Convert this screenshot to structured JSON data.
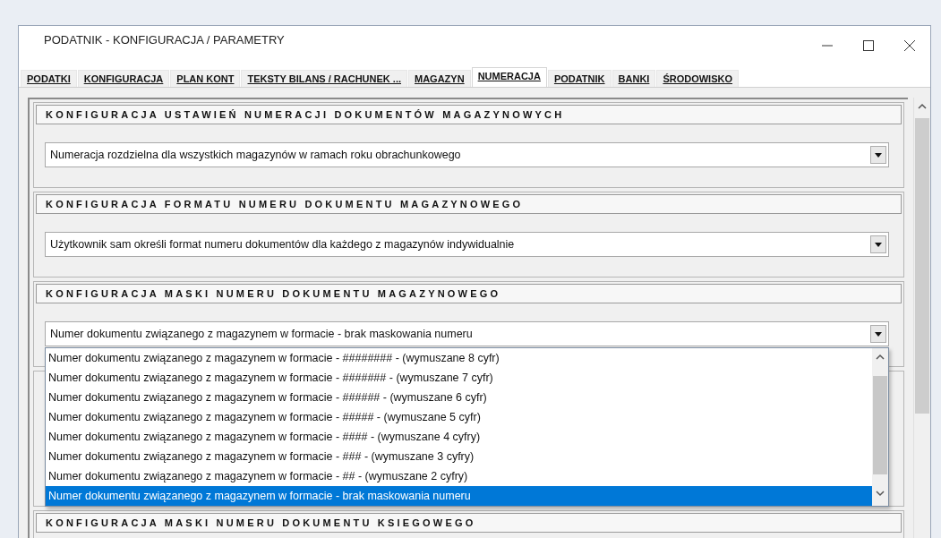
{
  "window": {
    "title": "PODATNIK  - KONFIGURACJA / PARAMETRY"
  },
  "tabs": [
    {
      "label": "PODATKI",
      "selected": false
    },
    {
      "label": "KONFIGURACJA",
      "selected": false
    },
    {
      "label": "PLAN KONT",
      "selected": false
    },
    {
      "label": "TEKSTY BILANS / RACHUNEK ...",
      "selected": false
    },
    {
      "label": "MAGAZYN",
      "selected": false
    },
    {
      "label": "NUMERACJA",
      "selected": true
    },
    {
      "label": "PODATNIK",
      "selected": false
    },
    {
      "label": "BANKI",
      "selected": false
    },
    {
      "label": "ŚRODOWISKO",
      "selected": false
    }
  ],
  "sections": [
    {
      "heading": "KONFIGURACJA USTAWIEŃ NUMERACJI DOKUMENTÓW MAGAZYNOWYCH",
      "value": "Numeracja rozdzielna dla wszystkich magazynów w ramach roku obrachunkowego"
    },
    {
      "heading": "KONFIGURACJA FORMATU NUMERU DOKUMENTU MAGAZYNOWEGO",
      "value": "Użytkownik sam określi format numeru dokumentów dla każdego z magazynów indywidualnie"
    },
    {
      "heading": "KONFIGURACJA MASKI NUMERU DOKUMENTU MAGAZYNOWEGO",
      "value": "Numer dokumentu związanego z magazynem w formacie - brak maskowania numeru",
      "options": [
        {
          "label": "Numer dokumentu związanego z magazynem w formacie - ######## - (wymuszane 8 cyfr)",
          "selected": false
        },
        {
          "label": "Numer dokumentu związanego z magazynem w formacie - ####### - (wymuszane 7 cyfr)",
          "selected": false
        },
        {
          "label": "Numer dokumentu związanego z magazynem w formacie - ###### - (wymuszane 6 cyfr)",
          "selected": false
        },
        {
          "label": "Numer dokumentu związanego z magazynem w formacie - ##### - (wymuszane 5 cyfr)",
          "selected": false
        },
        {
          "label": "Numer dokumentu związanego z magazynem w formacie - #### - (wymuszane 4 cyfry)",
          "selected": false
        },
        {
          "label": "Numer dokumentu związanego z magazynem w formacie - ### -  (wymuszane 3 cyfry)",
          "selected": false
        },
        {
          "label": "Numer dokumentu związanego z magazynem w formacie - ## - (wymuszane 2 cyfry)",
          "selected": false
        },
        {
          "label": "Numer dokumentu związanego z magazynem w formacie - brak maskowania numeru",
          "selected": true
        }
      ]
    }
  ],
  "last_heading": "KONFIGURACJA MASKI NUMERU DOKUMENTU KSIEGOWEGO"
}
